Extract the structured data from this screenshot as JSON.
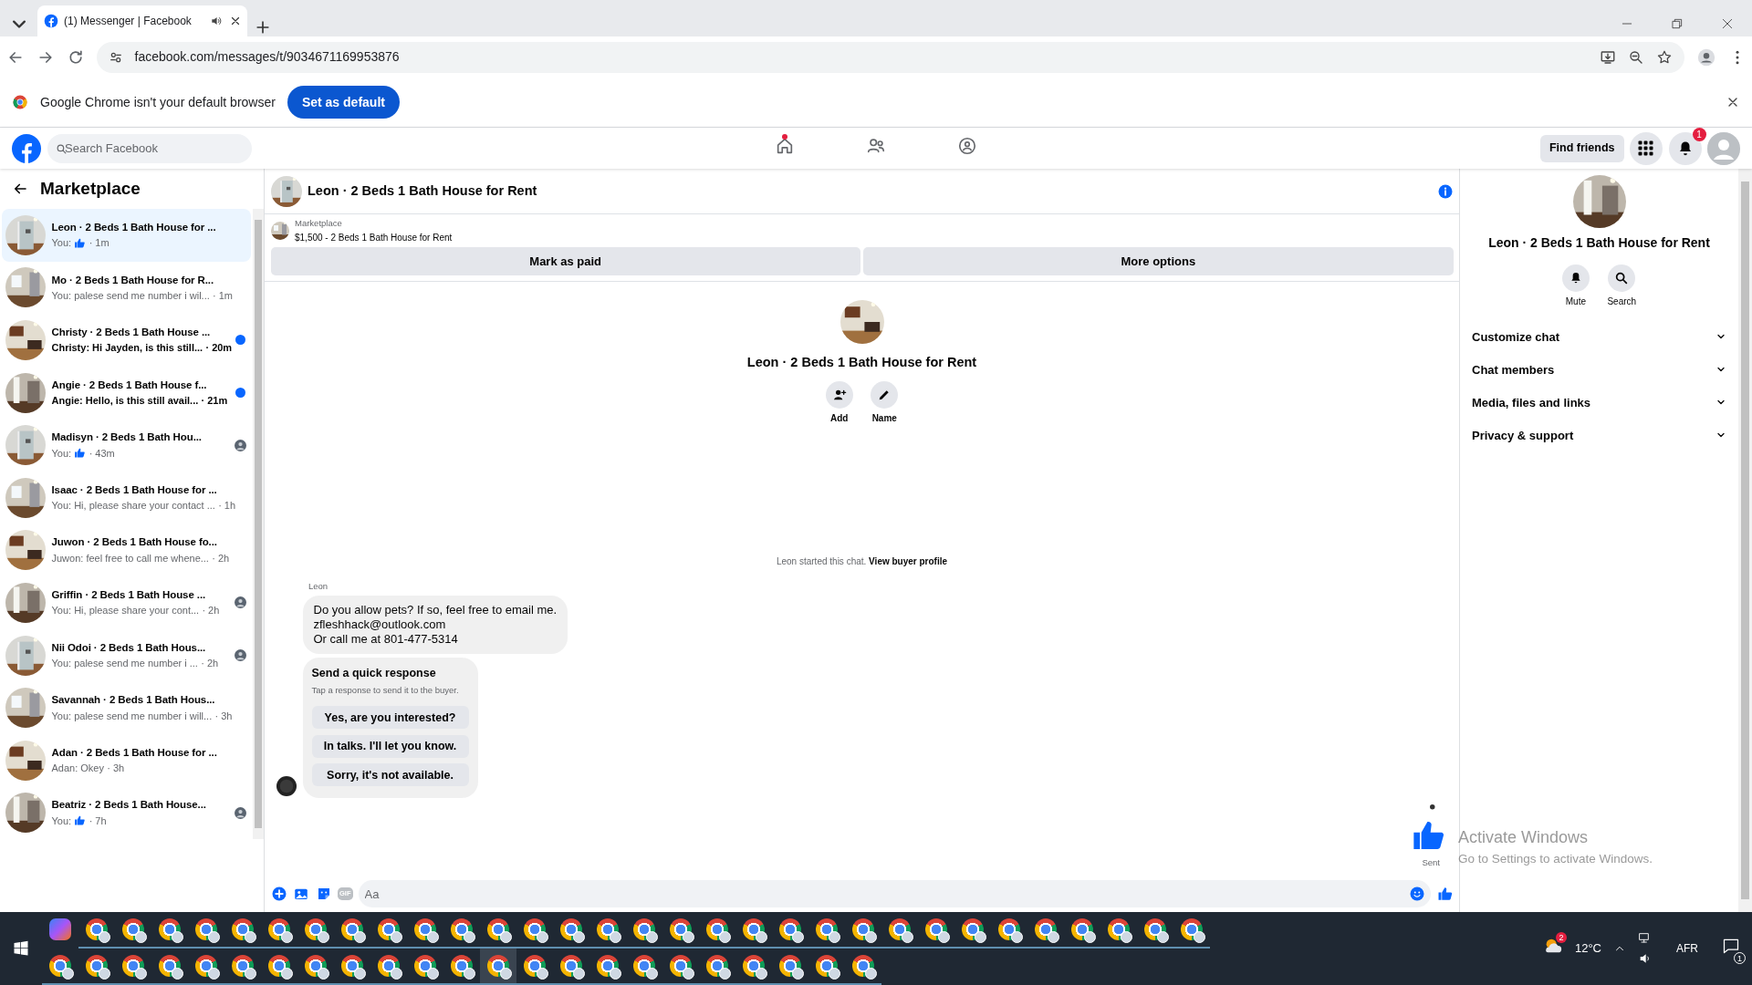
{
  "browser": {
    "tab": {
      "title": "(1) Messenger | Facebook",
      "audio": true
    },
    "url": "facebook.com/messages/t/9034671169953876",
    "infobar": {
      "message": "Google Chrome isn't your default browser",
      "button": "Set as default"
    }
  },
  "header": {
    "search": {
      "placeholder": "Search Facebook"
    },
    "nav": [
      {
        "kind": "home",
        "dot": true
      },
      {
        "kind": "friends",
        "dot": false
      },
      {
        "kind": "groups",
        "dot": false
      }
    ],
    "find_friends": "Find friends",
    "notifications": "1"
  },
  "sidebar": {
    "title": "Marketplace",
    "conversations": [
      {
        "title": "Leon · 2 Beds 1 Bath House for ...",
        "kind": "like",
        "preview": "You:",
        "time": "· 1m",
        "selected": true,
        "unread": false,
        "seen": false
      },
      {
        "title": "Mo · 2 Beds 1 Bath House for R...",
        "kind": "text",
        "preview": "You: palese send me number i wil...",
        "time": "· 1m",
        "selected": false,
        "unread": false,
        "seen": false
      },
      {
        "title": "Christy · 2 Beds 1 Bath House ...",
        "kind": "text",
        "preview": "Christy: Hi Jayden, is this still...",
        "time": "· 20m",
        "selected": false,
        "unread": true,
        "seen": false
      },
      {
        "title": "Angie · 2 Beds 1 Bath House f...",
        "kind": "text",
        "preview": "Angie: Hello, is this still avail...",
        "time": "· 21m",
        "selected": false,
        "unread": true,
        "seen": false
      },
      {
        "title": "Madisyn · 2 Beds 1 Bath Hou...",
        "kind": "like",
        "preview": "You:",
        "time": "· 43m",
        "selected": false,
        "unread": false,
        "seen": true
      },
      {
        "title": "Isaac · 2 Beds 1 Bath House for ...",
        "kind": "text",
        "preview": "You: Hi, please share your contact ...",
        "time": "· 1h",
        "selected": false,
        "unread": false,
        "seen": false
      },
      {
        "title": "Juwon · 2 Beds 1 Bath House fo...",
        "kind": "text",
        "preview": "Juwon: feel free to call me whene...",
        "time": "· 2h",
        "selected": false,
        "unread": false,
        "seen": false
      },
      {
        "title": "Griffin · 2 Beds 1 Bath House ...",
        "kind": "text",
        "preview": "You: Hi, please share your cont...",
        "time": "· 2h",
        "selected": false,
        "unread": false,
        "seen": true
      },
      {
        "title": "Nii Odoi · 2 Beds 1 Bath Hous...",
        "kind": "text",
        "preview": "You: palese send me number i ...",
        "time": "· 2h",
        "selected": false,
        "unread": false,
        "seen": true
      },
      {
        "title": "Savannah · 2 Beds 1 Bath Hous...",
        "kind": "text",
        "preview": "You: palese send me number i will...",
        "time": "· 3h",
        "selected": false,
        "unread": false,
        "seen": false
      },
      {
        "title": "Adan · 2 Beds 1 Bath House for ...",
        "kind": "text",
        "preview": "Adan: Okey",
        "time": "· 3h",
        "selected": false,
        "unread": false,
        "seen": false
      },
      {
        "title": "Beatriz · 2 Beds 1 Bath House...",
        "kind": "like",
        "preview": "You:",
        "time": "· 7h",
        "selected": false,
        "unread": false,
        "seen": true
      }
    ]
  },
  "chat": {
    "title": "Leon · 2 Beds 1 Bath House for Rent",
    "listing": {
      "label": "Marketplace",
      "detail": "$1,500 - 2 Beds 1 Bath House for Rent"
    },
    "buttons": [
      "Mark as paid",
      "More options"
    ],
    "intro": {
      "title": "Leon · 2 Beds 1 Bath House for Rent",
      "actions": [
        {
          "kind": "add",
          "label": "Add"
        },
        {
          "kind": "name",
          "label": "Name"
        }
      ]
    },
    "notice": {
      "text": "Leon started this chat.",
      "link": "View buyer profile"
    },
    "message": {
      "sender": "Leon",
      "lines": [
        "Do you allow pets? If so, feel free to email me.",
        "zfleshhack@outlook.com",
        "Or call me at 801-477-5314"
      ]
    },
    "quick_response": {
      "title": "Send a quick response",
      "subtitle": "Tap a response to send it to the buyer.",
      "options": [
        "Yes, are you interested?",
        "In talks. I'll let you know.",
        "Sorry, it's not available."
      ]
    },
    "sent": "Sent",
    "composer": {
      "gif": "GIF",
      "placeholder": "Aa"
    }
  },
  "details": {
    "title": "Leon · 2 Beds 1 Bath House for Rent",
    "actions": [
      {
        "kind": "mute",
        "label": "Mute"
      },
      {
        "kind": "search",
        "label": "Search"
      }
    ],
    "sections": [
      {
        "label": "Customize chat",
        "expanded": false
      },
      {
        "label": "Chat members",
        "expanded": false
      },
      {
        "label": "Media, files and links",
        "expanded": false
      },
      {
        "label": "Privacy & support",
        "expanded": false
      }
    ]
  },
  "activation": {
    "title": "Activate Windows",
    "subtitle": "Go to Settings to activate Windows."
  },
  "taskbar": {
    "rows": [
      [
        {
          "kind": "copilot",
          "selected": false
        },
        {
          "kind": "chrome",
          "selected": false
        },
        {
          "kind": "chrome",
          "selected": false
        },
        {
          "kind": "chrome",
          "selected": false
        },
        {
          "kind": "chrome",
          "selected": false
        },
        {
          "kind": "chrome",
          "selected": false
        },
        {
          "kind": "chrome",
          "selected": false
        },
        {
          "kind": "chrome",
          "selected": false
        },
        {
          "kind": "chrome",
          "selected": false
        },
        {
          "kind": "chrome",
          "selected": false
        },
        {
          "kind": "chrome",
          "selected": false
        },
        {
          "kind": "chrome",
          "selected": false
        },
        {
          "kind": "chrome",
          "selected": false
        },
        {
          "kind": "chrome",
          "selected": false
        },
        {
          "kind": "chrome",
          "selected": false
        },
        {
          "kind": "chrome",
          "selected": false
        },
        {
          "kind": "chrome",
          "selected": false
        },
        {
          "kind": "chrome",
          "selected": false
        },
        {
          "kind": "chrome",
          "selected": false
        },
        {
          "kind": "chrome",
          "selected": false
        },
        {
          "kind": "chrome",
          "selected": false
        },
        {
          "kind": "chrome",
          "selected": false
        },
        {
          "kind": "chrome",
          "selected": false
        },
        {
          "kind": "chrome",
          "selected": false
        },
        {
          "kind": "chrome",
          "selected": false
        },
        {
          "kind": "chrome",
          "selected": false
        },
        {
          "kind": "chrome",
          "selected": false
        },
        {
          "kind": "chrome",
          "selected": false
        },
        {
          "kind": "chrome",
          "selected": false
        },
        {
          "kind": "chrome",
          "selected": false
        },
        {
          "kind": "chrome",
          "selected": false
        },
        {
          "kind": "chrome",
          "selected": false
        }
      ],
      [
        {
          "kind": "chrome",
          "selected": false
        },
        {
          "kind": "chrome",
          "selected": false
        },
        {
          "kind": "chrome",
          "selected": false
        },
        {
          "kind": "chrome",
          "selected": false
        },
        {
          "kind": "chrome",
          "selected": false
        },
        {
          "kind": "chrome",
          "selected": false
        },
        {
          "kind": "chrome",
          "selected": false
        },
        {
          "kind": "chrome",
          "selected": false
        },
        {
          "kind": "chrome",
          "selected": false
        },
        {
          "kind": "chrome",
          "selected": false
        },
        {
          "kind": "chrome",
          "selected": false
        },
        {
          "kind": "chrome",
          "selected": false
        },
        {
          "kind": "chrome",
          "selected": true
        },
        {
          "kind": "chrome",
          "selected": false
        },
        {
          "kind": "chrome",
          "selected": false
        },
        {
          "kind": "chrome",
          "selected": false
        },
        {
          "kind": "chrome",
          "selected": false
        },
        {
          "kind": "chrome",
          "selected": false
        },
        {
          "kind": "chrome",
          "selected": false
        },
        {
          "kind": "chrome",
          "selected": false
        },
        {
          "kind": "chrome",
          "selected": false
        },
        {
          "kind": "chrome",
          "selected": false
        },
        {
          "kind": "chrome",
          "selected": false
        }
      ]
    ],
    "weather_badge": "2",
    "temperature": "12°C",
    "language": "AFR",
    "notifications": "1"
  }
}
